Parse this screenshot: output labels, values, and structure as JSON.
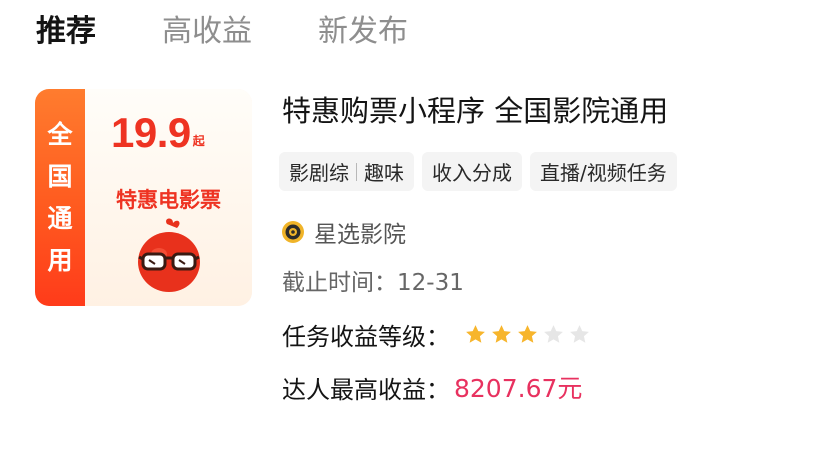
{
  "tabs": [
    {
      "label": "推荐",
      "active": true
    },
    {
      "label": "高收益",
      "active": false
    },
    {
      "label": "新发布",
      "active": false
    }
  ],
  "poster": {
    "strip_chars": [
      "全",
      "国",
      "通",
      "用"
    ],
    "price": "19.9",
    "price_unit": "起",
    "caption": "特惠电影票",
    "mascot_icon": "glasses-mascot-icon",
    "colors": {
      "accent": "#ee3322",
      "strip_top": "#ff7c2e",
      "strip_bottom": "#ff3b1a"
    }
  },
  "task": {
    "title": "特惠购票小程序 全国影院通用",
    "tags": [
      {
        "parts": [
          "影剧综",
          "趣味"
        ]
      },
      {
        "parts": [
          "收入分成"
        ]
      },
      {
        "parts": [
          "直播/视频任务"
        ]
      }
    ],
    "publisher": {
      "name": "星选影院",
      "logo_icon": "publisher-logo-icon"
    },
    "deadline": "截止时间：12-31",
    "level_label": "任务收益等级：",
    "level_stars": 3,
    "level_stars_max": 5,
    "earn_label": "达人最高收益：",
    "earn_value": "8207.67元"
  },
  "colors": {
    "earn_value": "#e8315f",
    "star_on": "#f7b52c",
    "star_off": "#e6e6e6"
  }
}
